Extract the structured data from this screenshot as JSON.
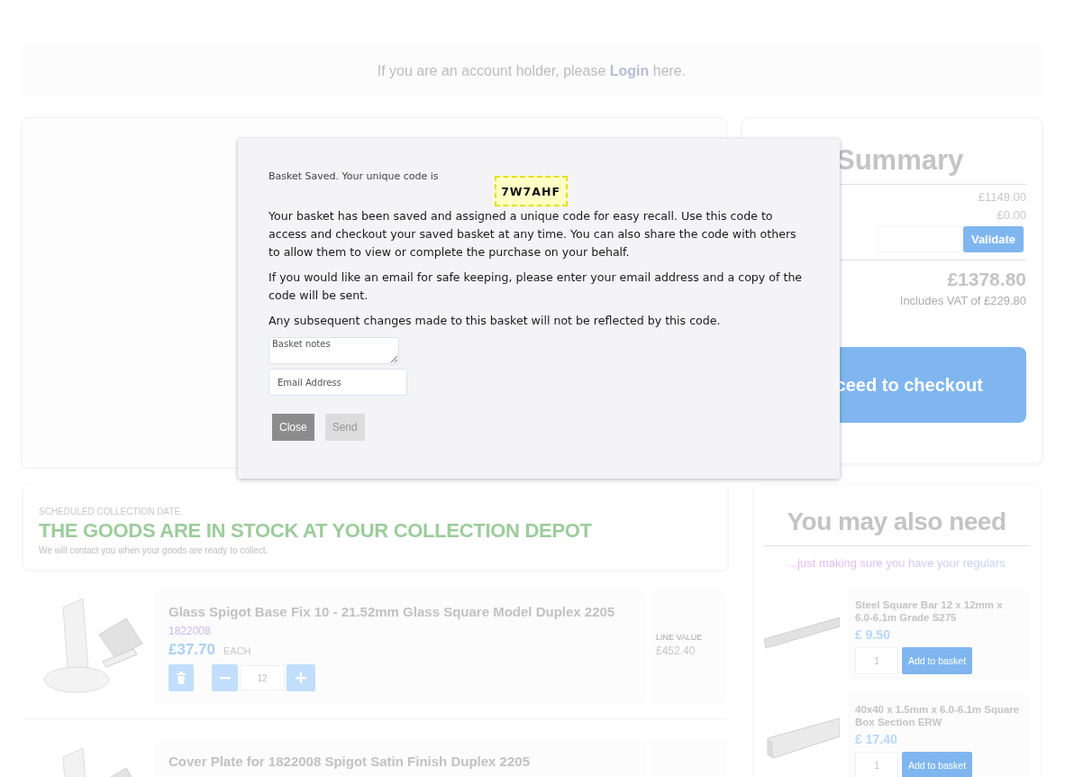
{
  "login_bar": {
    "before": "If you are an account holder, please ",
    "link": "Login",
    "after": " here."
  },
  "basket": {
    "collection": {
      "label": "SCHEDULED COLLECTION DATE",
      "headline": "THE GOODS ARE IN STOCK AT YOUR COLLECTION DEPOT",
      "note": "We will contact you when your goods are ready to collect."
    },
    "items": [
      {
        "title": "Glass Spigot Base Fix 10 - 21.52mm Glass Square Model Duplex 2205",
        "code": "1822008",
        "price": "£37.70",
        "unit": "EACH",
        "quantity": "12",
        "line_value_label": "LINE VALUE",
        "line_value": "£452.40"
      },
      {
        "title": "Cover Plate for 1822008 Spigot Satin Finish Duplex 2205"
      }
    ]
  },
  "summary": {
    "title": "Summary",
    "values": [
      "£1149.00",
      "£0.00"
    ],
    "voucher_button": "Validate",
    "total": "£1378.80",
    "vat_note": "Includes VAT of £229.80",
    "checkout_button": "ceed to checkout"
  },
  "recommendations": {
    "title": "You may also need",
    "subtitle": "...just making sure you have your regulars",
    "items": [
      {
        "name": "Steel Square Bar 12 x 12mm x 6.0-6.1m Grade S275",
        "price": "£ 9.50",
        "quantity": "1",
        "button": "Add to basket"
      },
      {
        "name": "40x40 x 1.5mm x 6.0-6.1m Square Box Section ERW",
        "price": "£ 17.40",
        "quantity": "1",
        "button": "Add to basket"
      }
    ]
  },
  "modal": {
    "intro": "Basket Saved. Your unique code is",
    "code": "7W7AHF",
    "paragraphs": [
      "Your basket has been saved and assigned a unique code for easy recall. Use this code to access and checkout your saved basket at any time. You can also share the code with others to allow them to view or complete the purchase on your behalf.",
      "If you would like an email for safe keeping, please enter your email address and a copy of the code will be sent.",
      "Any subsequent changes made to this basket will not be reflected by this code."
    ],
    "notes_placeholder": "Basket notes",
    "email_placeholder": "Email Address",
    "buttons": [
      {
        "label": "Close",
        "disabled": false
      },
      {
        "label": "Send",
        "disabled": true
      }
    ]
  }
}
